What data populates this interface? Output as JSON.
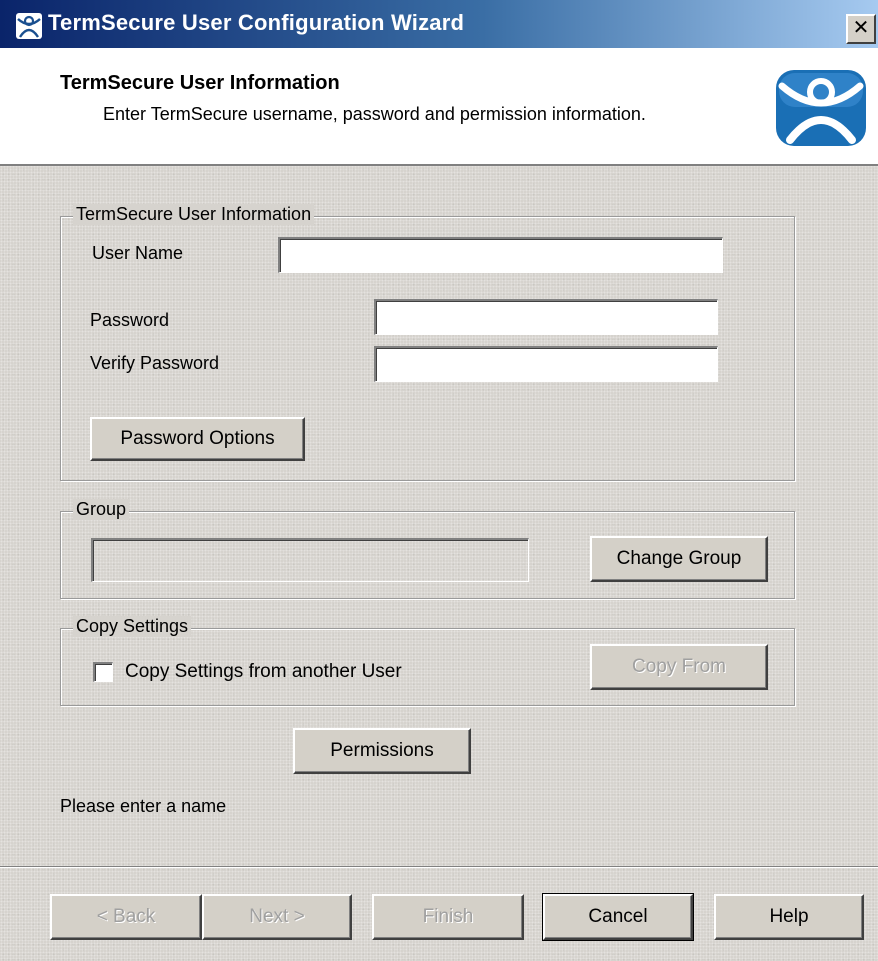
{
  "window": {
    "title": "TermSecure User Configuration Wizard",
    "close_label": "✕",
    "title_gradient": [
      "#0a246a",
      "#3a6ea5",
      "#a6caf0"
    ]
  },
  "header": {
    "title": "TermSecure User Information",
    "subtitle": "Enter TermSecure username, password and permission information.",
    "logo_icon": "thinstuff-person-logo",
    "logo_color": "#1a6fb5"
  },
  "user_info": {
    "legend": "TermSecure User Information",
    "username_label": "User Name",
    "username_value": "",
    "password_label": "Password",
    "password_value": "",
    "verify_label": "Verify Password",
    "verify_value": "",
    "password_options_button": "Password Options"
  },
  "group": {
    "legend": "Group",
    "value": "",
    "change_button": "Change Group"
  },
  "copy_settings": {
    "legend": "Copy Settings",
    "checkbox_label": "Copy Settings from another User",
    "checked": false,
    "copy_from_button": "Copy From"
  },
  "permissions_button": "Permissions",
  "status_text": "Please enter a name",
  "footer": {
    "back": "< Back",
    "next": "Next >",
    "finish": "Finish",
    "cancel": "Cancel",
    "help": "Help"
  }
}
